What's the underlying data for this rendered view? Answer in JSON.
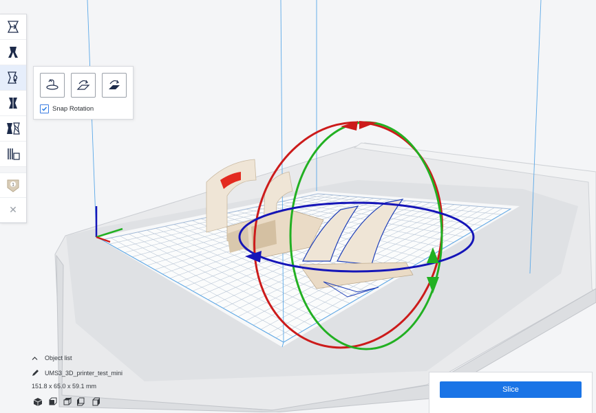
{
  "toolbar": {
    "tools": [
      {
        "name": "move-tool",
        "icon": "move-icon"
      },
      {
        "name": "scale-tool",
        "icon": "scale-icon"
      },
      {
        "name": "rotate-tool",
        "icon": "rotate-icon",
        "active": true
      },
      {
        "name": "mirror-tool",
        "icon": "mirror-icon"
      },
      {
        "name": "per-model-settings-tool",
        "icon": "per-model-settings-icon"
      },
      {
        "name": "support-blocker-tool",
        "icon": "support-blocker-icon"
      }
    ],
    "extruder_badge": "1",
    "close_symbol": "✕"
  },
  "rotate_panel": {
    "buttons": [
      "reset-rotation-icon",
      "lay-flat-icon",
      "select-face-to-align-icon"
    ],
    "snap_rotation_label": "Snap Rotation",
    "snap_rotation_checked": true
  },
  "object_info": {
    "object_list_label": "Object list",
    "object_name": "UMS3_3D_printer_test_mini",
    "dimensions": "151.8 x 65.0 x 59.1 mm",
    "view_buttons": [
      "view-3d-icon",
      "view-front-icon",
      "view-top-icon",
      "view-left-icon",
      "view-right-icon"
    ]
  },
  "slice_panel": {
    "slice_label": "Slice"
  },
  "colors": {
    "accent": "#1a74e6",
    "rotate_x": "#cc1b1b",
    "rotate_y": "#22b022",
    "rotate_z": "#1515b8",
    "build_volume_lines": "#5aa8e8"
  }
}
